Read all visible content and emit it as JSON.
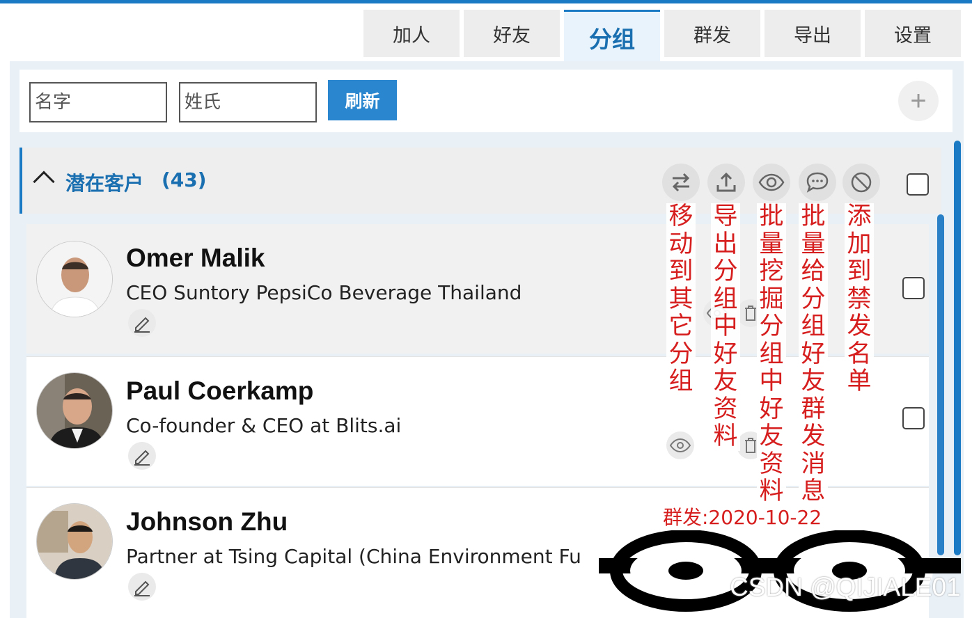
{
  "tabs": [
    {
      "label": "加人"
    },
    {
      "label": "好友"
    },
    {
      "label": "分组",
      "active": true
    },
    {
      "label": "群发"
    },
    {
      "label": "导出"
    },
    {
      "label": "设置"
    }
  ],
  "search": {
    "name_placeholder": "名字",
    "surname_placeholder": "姓氏",
    "refresh_label": "刷新",
    "add_symbol": "+"
  },
  "group": {
    "name": "潜在客户",
    "count": "(43)"
  },
  "actions": [
    {
      "icon": "swap-arrows-icon",
      "annotation": "移动到其它分组"
    },
    {
      "icon": "export-upload-icon",
      "annotation": "导出分组中好友资料"
    },
    {
      "icon": "eye-icon",
      "annotation": "批量挖掘分组中好友资料"
    },
    {
      "icon": "chat-bubble-icon",
      "annotation": "批量给分组好友群发消息"
    },
    {
      "icon": "ban-icon",
      "annotation": "添加到禁发名单"
    }
  ],
  "contacts": [
    {
      "name": "Omer Malik",
      "headline": "CEO Suntory PepsiCo Beverage Thailand"
    },
    {
      "name": "Paul Coerkamp",
      "headline": "Co-founder & CEO at Blits.ai"
    },
    {
      "name": "Johnson Zhu",
      "headline": "Partner at Tsing Capital (China Environment Fu"
    }
  ],
  "send_date": "群发:2020-10-22",
  "watermark": "CSDN @QIJIALE01",
  "colors": {
    "accent": "#1a7bc4",
    "annotation_red": "#d61e1e",
    "panel_bg": "#e9f0f6"
  }
}
